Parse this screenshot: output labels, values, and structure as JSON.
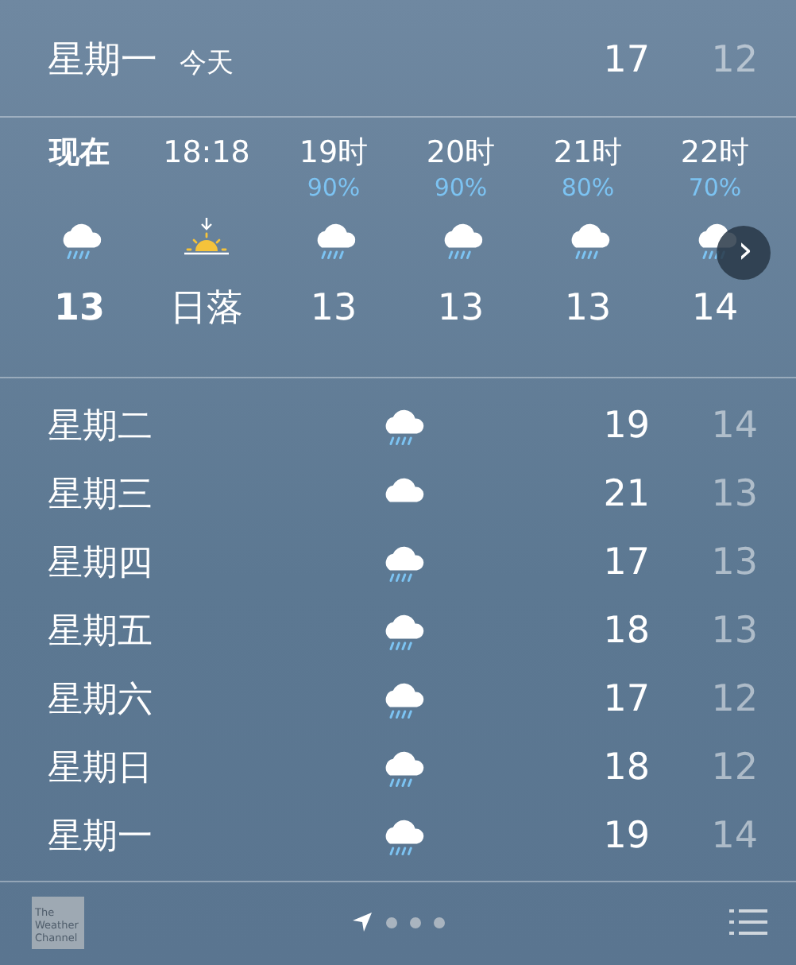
{
  "today": {
    "day": "星期一",
    "label": "今天",
    "high": "17",
    "low": "12"
  },
  "hourly": [
    {
      "time": "现在",
      "current": true,
      "kind": "rain",
      "temp": "13"
    },
    {
      "time": "18:18",
      "current": false,
      "kind": "sunset",
      "temp": "日落"
    },
    {
      "time": "19时",
      "current": false,
      "chance": "90%",
      "kind": "rain",
      "temp": "13"
    },
    {
      "time": "20时",
      "current": false,
      "chance": "90%",
      "kind": "rain",
      "temp": "13"
    },
    {
      "time": "21时",
      "current": false,
      "chance": "80%",
      "kind": "rain",
      "temp": "13"
    },
    {
      "time": "22时",
      "current": false,
      "chance": "70%",
      "kind": "rain",
      "temp": "14"
    }
  ],
  "scroll_button": {
    "label": "›"
  },
  "daily": [
    {
      "day": "星期二",
      "kind": "rain",
      "high": "19",
      "low": "14"
    },
    {
      "day": "星期三",
      "kind": "cloud",
      "high": "21",
      "low": "13"
    },
    {
      "day": "星期四",
      "kind": "rain",
      "high": "17",
      "low": "13"
    },
    {
      "day": "星期五",
      "kind": "rain",
      "high": "18",
      "low": "13"
    },
    {
      "day": "星期六",
      "kind": "rain",
      "high": "17",
      "low": "12"
    },
    {
      "day": "星期日",
      "kind": "rain",
      "high": "18",
      "low": "12"
    },
    {
      "day": "星期一",
      "kind": "rain",
      "high": "19",
      "low": "14"
    }
  ],
  "bottom_bar": {
    "logo": "The Weather Channel",
    "pages": [
      {
        "kind": "location",
        "selected": true
      },
      {
        "kind": "dot",
        "selected": false
      },
      {
        "kind": "dot",
        "selected": false
      },
      {
        "kind": "dot",
        "selected": false
      }
    ]
  }
}
